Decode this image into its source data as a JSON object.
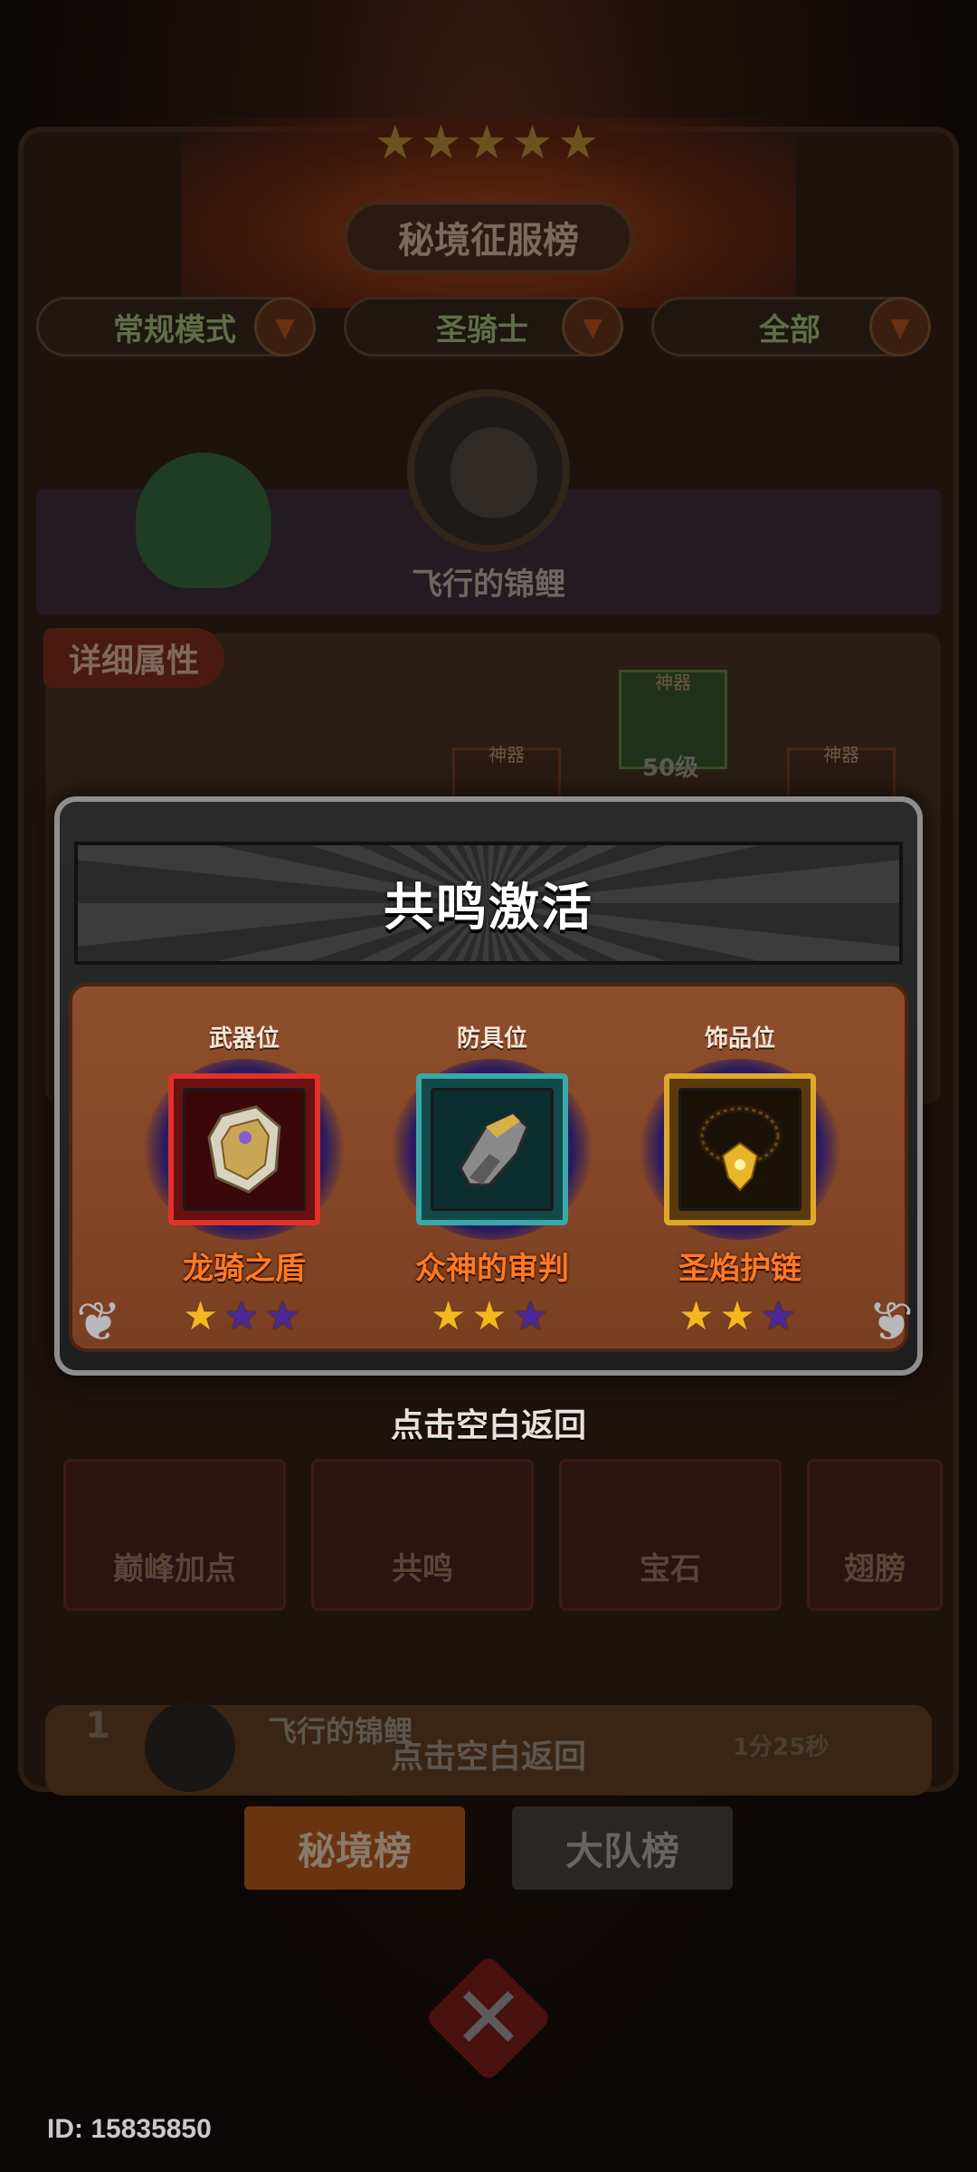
{
  "screen": {
    "title": "秘境征服榜",
    "filters": [
      {
        "label": "常规模式"
      },
      {
        "label": "圣骑士"
      },
      {
        "label": "全部"
      }
    ],
    "player_name": "飞行的锦鲤",
    "detail_tab": "详细属性",
    "slot_labels": [
      "神器",
      "神器",
      "神器"
    ],
    "level_text": "50级",
    "function_buttons": [
      "巅峰加点",
      "共鸣",
      "宝石",
      "翅膀"
    ],
    "rank_row": {
      "rank": "1",
      "name": "飞行的锦鲤",
      "time": "1分25秒"
    },
    "ghost_hint": "点击空白返回",
    "bottom_tabs": [
      {
        "label": "秘境榜",
        "active": true
      },
      {
        "label": "大队榜",
        "active": false
      }
    ],
    "user_id": "ID: 15835850"
  },
  "dialog": {
    "title": "共鸣激活",
    "slots": [
      {
        "caption": "武器位",
        "item_name": "龙骑之盾",
        "stars_filled": 1,
        "stars_total": 3,
        "frame_color": "#e0322a",
        "icon": "shield-icon"
      },
      {
        "caption": "防具位",
        "item_name": "众神的审判",
        "stars_filled": 2,
        "stars_total": 3,
        "frame_color": "#3aa8a8",
        "icon": "gauntlet-icon"
      },
      {
        "caption": "饰品位",
        "item_name": "圣焰护链",
        "stars_filled": 2,
        "stars_total": 3,
        "frame_color": "#e0a82a",
        "icon": "necklace-icon"
      }
    ],
    "dismiss_hint": "点击空白返回"
  },
  "colors": {
    "item_name": "#ff7a24",
    "star_on": "#f4b81f",
    "star_off": "#4a2a9a",
    "active_tab": "#6a3410"
  }
}
